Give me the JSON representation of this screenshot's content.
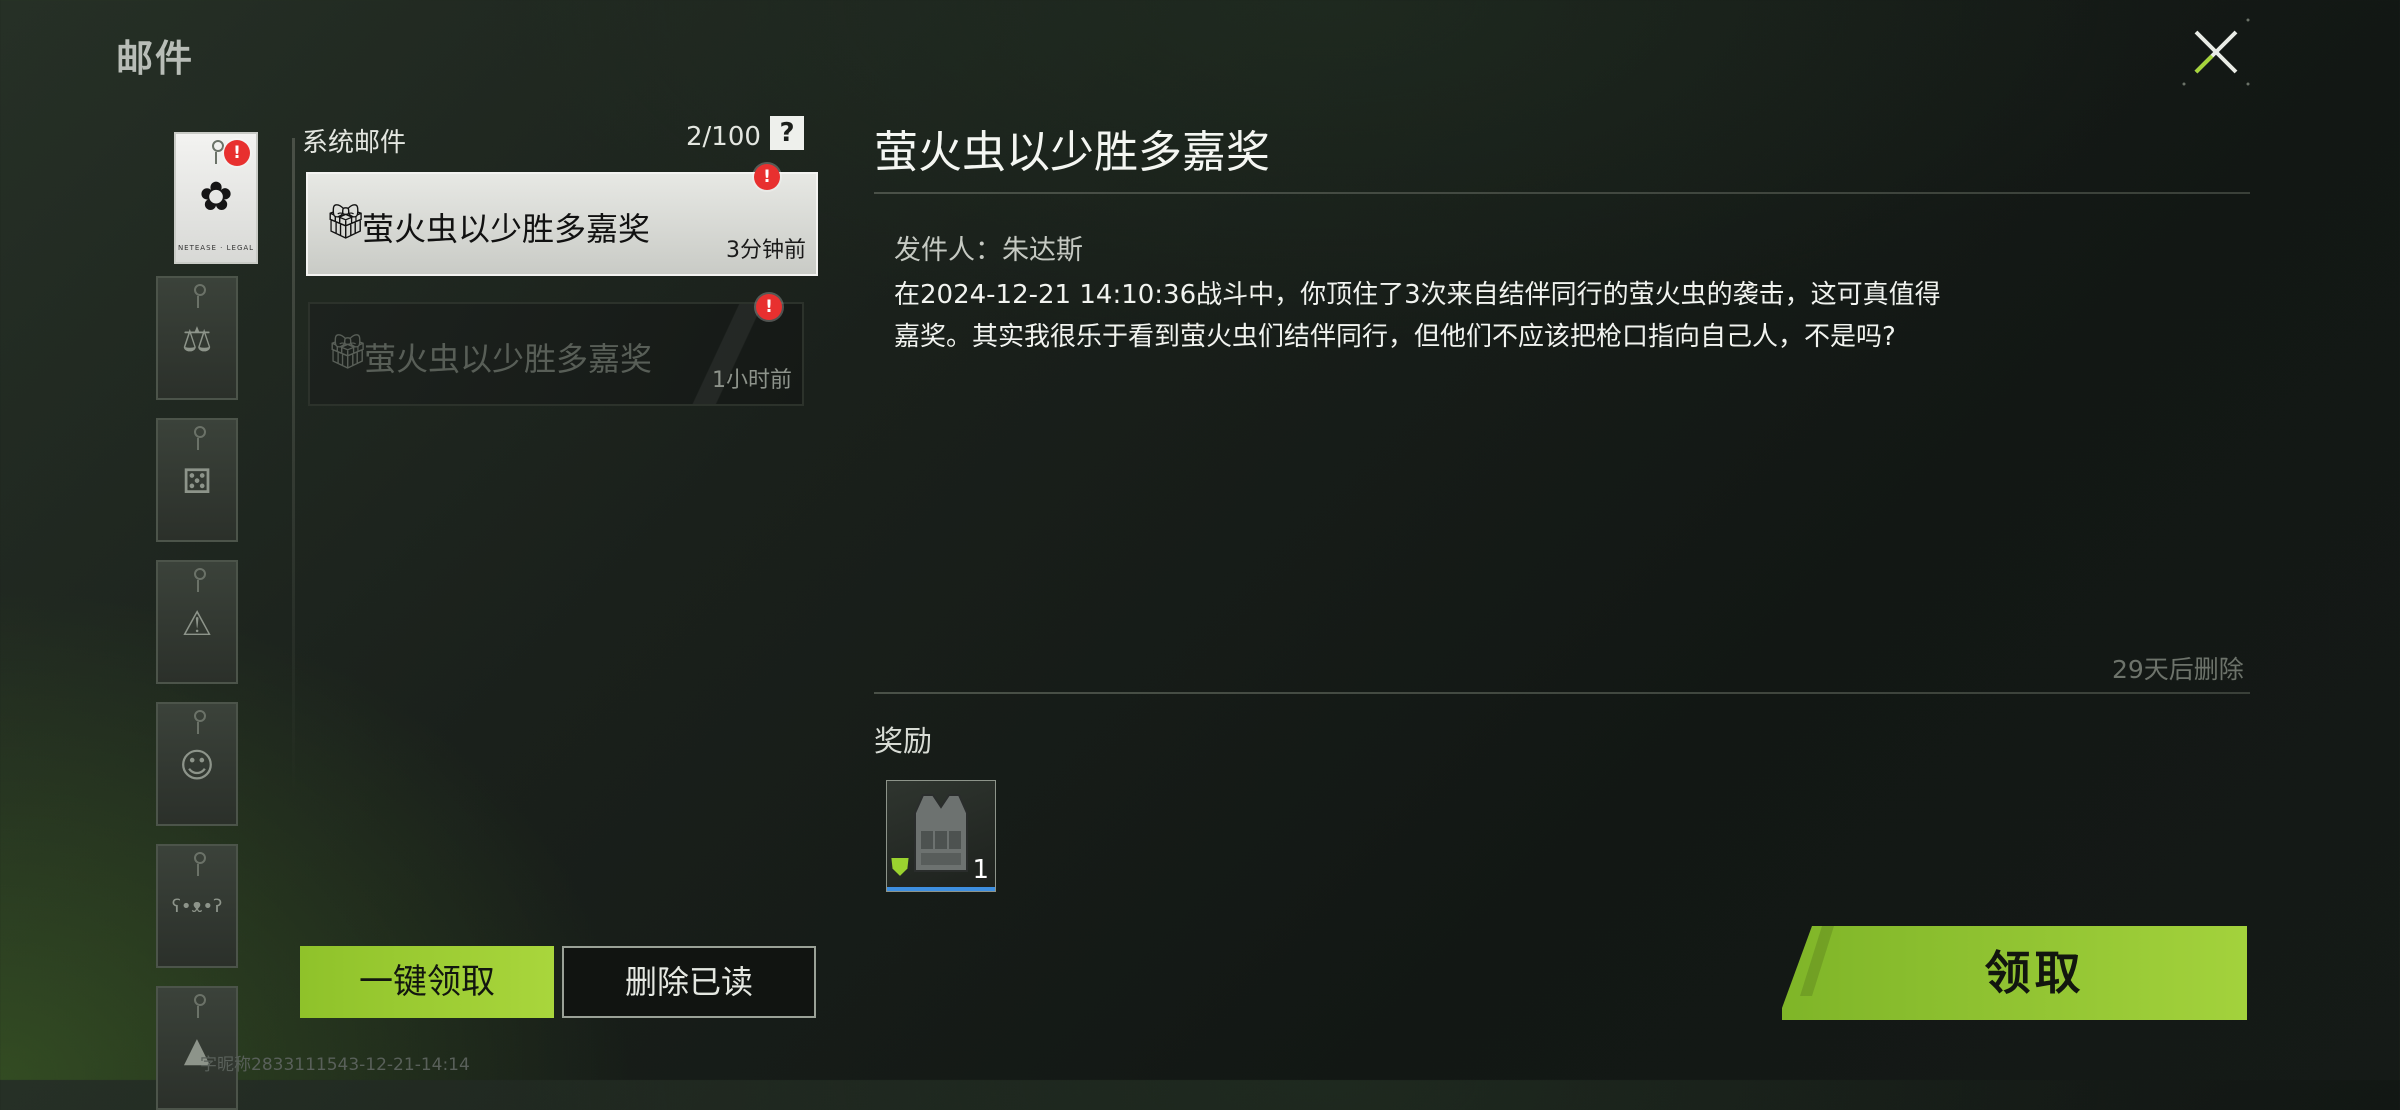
{
  "page": {
    "title": "邮件"
  },
  "categories": [
    {
      "id": "system",
      "icon": "flower-icon",
      "glyph": "✿",
      "sub": "NETEASE · LEGAL",
      "active": true,
      "unread": true
    },
    {
      "id": "judge",
      "icon": "gavel-icon",
      "glyph": "⚖",
      "sub": "",
      "active": false
    },
    {
      "id": "dice",
      "icon": "dice-icon",
      "glyph": "⚄",
      "sub": "",
      "active": false
    },
    {
      "id": "warning",
      "icon": "warning-icon",
      "glyph": "⚠",
      "sub": "",
      "active": false
    },
    {
      "id": "person",
      "icon": "person-icon",
      "glyph": "☺",
      "sub": "",
      "active": false
    },
    {
      "id": "bear",
      "icon": "bear-icon",
      "glyph": "ʕ•ᴥ•ʔ",
      "sub": "",
      "active": false
    },
    {
      "id": "triangle",
      "icon": "triangle-logo-icon",
      "glyph": "▲",
      "sub": "",
      "active": false
    }
  ],
  "list": {
    "title": "系统邮件",
    "count": "2/100",
    "help": "?",
    "badge": "!",
    "mails": [
      {
        "subject": "萤火虫以少胜多嘉奖",
        "time": "3分钟前",
        "selected": true,
        "unread": true
      },
      {
        "subject": "萤火虫以少胜多嘉奖",
        "time": "1小时前",
        "selected": false,
        "unread": true
      }
    ]
  },
  "actions": {
    "claim_all": "一键领取",
    "delete_read": "删除已读"
  },
  "footer": {
    "text": "字昵称2833111543-12-21-14:14"
  },
  "detail": {
    "title": "萤火虫以少胜多嘉奖",
    "sender": "发件人：朱达斯",
    "body_line1": "在2024-12-21 14:10:36战斗中，你顶住了3次来自结伴同行的萤火虫的袭击，这可真值得",
    "body_line2": "嘉奖。其实我很乐于看到萤火虫们结伴同行，但他们不应该把枪口指向自己人，不是吗?",
    "expire": "29天后删除",
    "reward_label": "奖励",
    "reward_qty": "1",
    "claim": "领取"
  },
  "colors": {
    "accent": "#9fd034",
    "badge": "#e8302f",
    "bg": "#161b17"
  }
}
